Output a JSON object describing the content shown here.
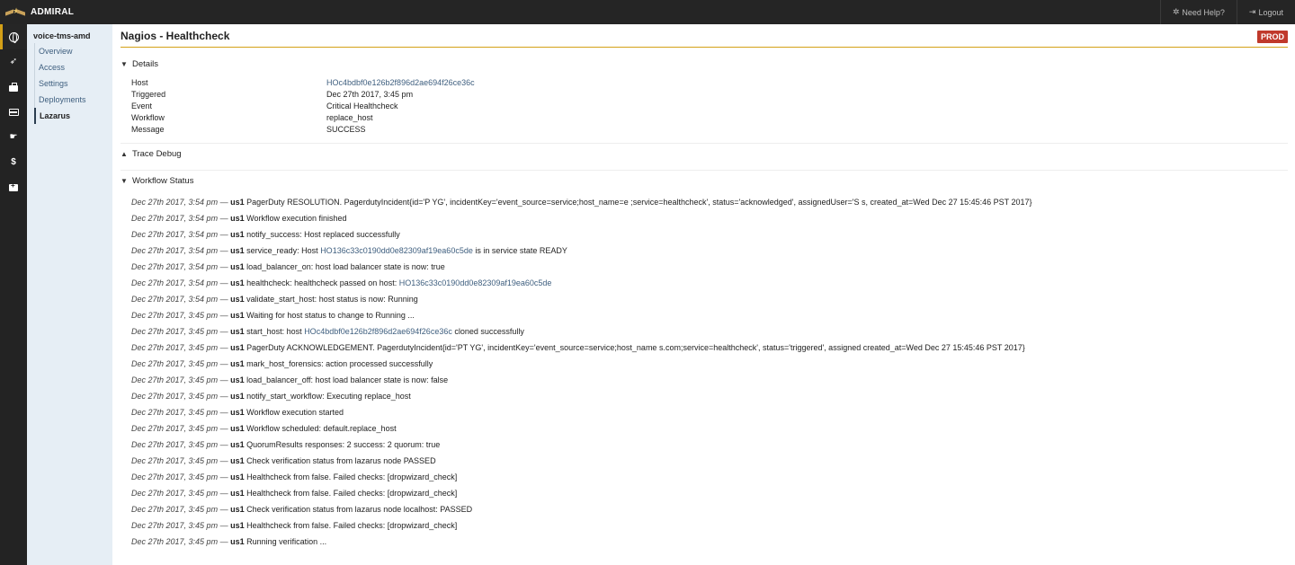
{
  "topbar": {
    "brand": "ADMIRAL",
    "help_label": "Need Help?",
    "logout_label": "Logout",
    "icons": {
      "help": "gear-icon",
      "logout": "sign-out-icon"
    }
  },
  "icon_rail": {
    "items": [
      {
        "icon": "globe-icon",
        "glyph": ""
      },
      {
        "icon": "rocket-icon",
        "glyph": "➶"
      },
      {
        "icon": "briefcase-icon",
        "glyph": ""
      },
      {
        "icon": "card-icon",
        "glyph": ""
      },
      {
        "icon": "hand-icon",
        "glyph": "☛"
      },
      {
        "icon": "dollar-icon",
        "glyph": "$"
      },
      {
        "icon": "medkit-icon",
        "glyph": ""
      }
    ]
  },
  "subnav": {
    "app_name": "voice-tms-amd",
    "items": [
      {
        "label": "Overview"
      },
      {
        "label": "Access"
      },
      {
        "label": "Settings"
      },
      {
        "label": "Deployments"
      },
      {
        "label": "Lazarus",
        "active": true
      }
    ]
  },
  "page": {
    "title": "Nagios - Healthcheck",
    "env_badge": "PROD",
    "colors": {
      "accent": "#d4a017",
      "badge": "#c0392b",
      "link": "#3f5f7f"
    }
  },
  "sections": {
    "details": "Details",
    "trace": "Trace Debug",
    "workflow": "Workflow Status"
  },
  "details": [
    {
      "key": "Host",
      "value": "HOc4bdbf0e126b2f896d2ae694f26ce36c"
    },
    {
      "key": "Triggered",
      "value": "Dec 27th 2017, 3:45 pm"
    },
    {
      "key": "Event",
      "value": "Critical Healthcheck"
    },
    {
      "key": "Workflow",
      "value": "replace_host"
    },
    {
      "key": "Message",
      "value": "SUCCESS"
    }
  ],
  "log": {
    "dash": "—",
    "entries": [
      {
        "time": "Dec 27th 2017, 3:54 pm",
        "region": "us1",
        "text": "PagerDuty RESOLUTION.  PagerdutyIncident{id='P         YG', incidentKey='event_source=service;host_name=e                                                                   ;service=healthcheck', status='acknowledged', assignedUser='S               s, created_at=Wed Dec 27 15:45:46 PST 2017}"
      },
      {
        "time": "Dec 27th 2017, 3:54 pm",
        "region": "us1",
        "text": "Workflow execution finished"
      },
      {
        "time": "Dec 27th 2017, 3:54 pm",
        "region": "us1",
        "text": "notify_success: Host replaced successfully"
      },
      {
        "time": "Dec 27th 2017, 3:54 pm",
        "region": "us1",
        "text": "service_ready: Host ",
        "link": "HO136c33c0190dd0e82309af19ea60c5de",
        "after": " is in service state READY"
      },
      {
        "time": "Dec 27th 2017, 3:54 pm",
        "region": "us1",
        "text": "load_balancer_on: host load balancer state is now: true"
      },
      {
        "time": "Dec 27th 2017, 3:54 pm",
        "region": "us1",
        "text": "healthcheck: healthcheck passed on host: ",
        "link": "HO136c33c0190dd0e82309af19ea60c5de"
      },
      {
        "time": "Dec 27th 2017, 3:54 pm",
        "region": "us1",
        "text": "validate_start_host: host status is now: Running"
      },
      {
        "time": "Dec 27th 2017, 3:45 pm",
        "region": "us1",
        "text": "Waiting for host status to change to Running ..."
      },
      {
        "time": "Dec 27th 2017, 3:45 pm",
        "region": "us1",
        "text": "start_host: host ",
        "link": "HOc4bdbf0e126b2f896d2ae694f26ce36c",
        "after": " cloned successfully"
      },
      {
        "time": "Dec 27th 2017, 3:45 pm",
        "region": "us1",
        "text": "PagerDuty ACKNOWLEDGEMENT.  PagerdutyIncident{id='PT    YG', incidentKey='event_source=service;host_name                                                                           s.com;service=healthcheck', status='triggered', assigned                                        created_at=Wed Dec 27 15:45:46 PST 2017}"
      },
      {
        "time": "Dec 27th 2017, 3:45 pm",
        "region": "us1",
        "text": "mark_host_forensics: action processed successfully"
      },
      {
        "time": "Dec 27th 2017, 3:45 pm",
        "region": "us1",
        "text": "load_balancer_off: host load balancer state is now: false"
      },
      {
        "time": "Dec 27th 2017, 3:45 pm",
        "region": "us1",
        "text": "notify_start_workflow: Executing replace_host"
      },
      {
        "time": "Dec 27th 2017, 3:45 pm",
        "region": "us1",
        "text": "Workflow execution started"
      },
      {
        "time": "Dec 27th 2017, 3:45 pm",
        "region": "us1",
        "text": "Workflow scheduled: default.replace_host"
      },
      {
        "time": "Dec 27th 2017, 3:45 pm",
        "region": "us1",
        "text": "QuorumResults responses: 2 success: 2 quorum: true"
      },
      {
        "time": "Dec 27th 2017, 3:45 pm",
        "region": "us1",
        "text": "Check verification status from lazarus node                PASSED"
      },
      {
        "time": "Dec 27th 2017, 3:45 pm",
        "region": "us1",
        "text": "Healthcheck from                       false. Failed checks: [dropwizard_check]"
      },
      {
        "time": "Dec 27th 2017, 3:45 pm",
        "region": "us1",
        "text": "Healthcheck from                    false. Failed checks: [dropwizard_check]"
      },
      {
        "time": "Dec 27th 2017, 3:45 pm",
        "region": "us1",
        "text": "Check verification status from lazarus node localhost:  PASSED"
      },
      {
        "time": "Dec 27th 2017, 3:45 pm",
        "region": "us1",
        "text": "Healthcheck from                       false. Failed checks: [dropwizard_check]"
      },
      {
        "time": "Dec 27th 2017, 3:45 pm",
        "region": "us1",
        "text": "Running verification ..."
      }
    ]
  }
}
